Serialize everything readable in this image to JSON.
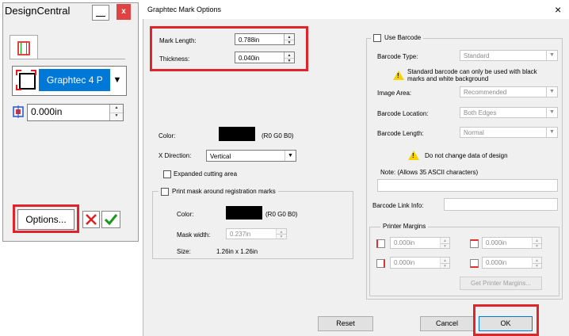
{
  "design_central": {
    "title": "DesignCentral",
    "minimize_label": "",
    "close_label": "x",
    "mark_type": "Graphtec 4 P",
    "distance_value": "0.000in",
    "options_label": "Options..."
  },
  "dialog": {
    "title": "Graphtec Mark Options",
    "close_label": "×",
    "mark_length_label": "Mark Length:",
    "mark_length_value": "0.788in",
    "thickness_label": "Thickness:",
    "thickness_value": "0.040in",
    "color_label": "Color:",
    "color_value": "(R0 G0 B0)",
    "x_direction_label": "X Direction:",
    "x_direction_value": "Vertical",
    "expanded_cutting_label": "Expanded cutting area",
    "print_mask_label": "Print mask around registration marks",
    "mask_color_label": "Color:",
    "mask_color_value": "(R0 G0 B0)",
    "mask_width_label": "Mask width:",
    "mask_width_value": "0.237in",
    "size_label": "Size:",
    "size_value": "1.26in x 1.26in",
    "use_barcode_label": "Use Barcode",
    "barcode_type_label": "Barcode Type:",
    "barcode_type_value": "Standard",
    "barcode_warning_line1": "Standard barcode can only be used with black",
    "barcode_warning_line2": "marks and white background",
    "image_area_label": "Image Area:",
    "image_area_value": "Recommended",
    "barcode_location_label": "Barcode Location:",
    "barcode_location_value": "Both Edges",
    "barcode_length_label": "Barcode Length:",
    "barcode_length_value": "Normal",
    "design_warning": "Do not change data of design",
    "note_label": "Note: (Allows 35 ASCII characters)",
    "note_value": "",
    "barcode_link_label": "Barcode Link Info:",
    "barcode_link_value": "",
    "printer_margins_label": "Printer Margins",
    "margin_top_left": "0.000in",
    "margin_top_right": "0.000in",
    "margin_bottom_left": "0.000in",
    "margin_bottom_right": "0.000in",
    "get_printer_margins_label": "Get Printer Margins...",
    "reset_label": "Reset",
    "cancel_label": "Cancel",
    "ok_label": "OK"
  },
  "colors": {
    "highlight": "#e0242c",
    "selection": "#0078d7"
  }
}
